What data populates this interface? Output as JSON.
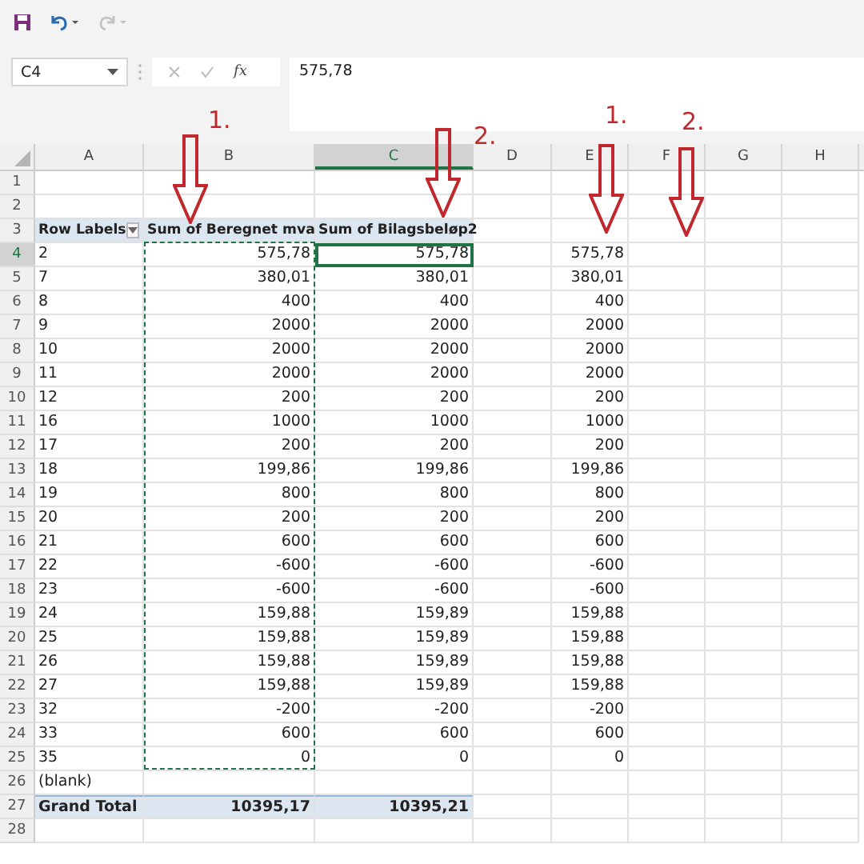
{
  "toolbar": {
    "redo_disabled": true
  },
  "formula_bar": {
    "name_box": "C4",
    "function_label": "fx",
    "value": "575,78"
  },
  "annotations": [
    {
      "label": "1."
    },
    {
      "label": "2."
    },
    {
      "label": "1."
    },
    {
      "label": "2."
    }
  ],
  "columns": [
    {
      "label": "A",
      "selected": false
    },
    {
      "label": "B",
      "selected": false
    },
    {
      "label": "C",
      "selected": true
    },
    {
      "label": "D",
      "selected": false
    },
    {
      "label": "E",
      "selected": false
    },
    {
      "label": "F",
      "selected": false
    },
    {
      "label": "G",
      "selected": false
    },
    {
      "label": "H",
      "selected": false
    }
  ],
  "rows": [
    {
      "n": "1",
      "selected": false
    },
    {
      "n": "2",
      "selected": false
    },
    {
      "n": "3",
      "kind": "header",
      "selected": false,
      "a": "Row Labels",
      "b": "Sum of Beregnet mva",
      "c": "Sum of Bilagsbeløp2"
    },
    {
      "n": "4",
      "selected": true,
      "a": "2",
      "b": "575,78",
      "c": "575,78",
      "e": "575,78"
    },
    {
      "n": "5",
      "selected": false,
      "a": "7",
      "b": "380,01",
      "c": "380,01",
      "e": "380,01"
    },
    {
      "n": "6",
      "selected": false,
      "a": "8",
      "b": "400",
      "c": "400",
      "e": "400"
    },
    {
      "n": "7",
      "selected": false,
      "a": "9",
      "b": "2000",
      "c": "2000",
      "e": "2000"
    },
    {
      "n": "8",
      "selected": false,
      "a": "10",
      "b": "2000",
      "c": "2000",
      "e": "2000"
    },
    {
      "n": "9",
      "selected": false,
      "a": "11",
      "b": "2000",
      "c": "2000",
      "e": "2000"
    },
    {
      "n": "10",
      "selected": false,
      "a": "12",
      "b": "200",
      "c": "200",
      "e": "200"
    },
    {
      "n": "11",
      "selected": false,
      "a": "16",
      "b": "1000",
      "c": "1000",
      "e": "1000"
    },
    {
      "n": "12",
      "selected": false,
      "a": "17",
      "b": "200",
      "c": "200",
      "e": "200"
    },
    {
      "n": "13",
      "selected": false,
      "a": "18",
      "b": "199,86",
      "c": "199,86",
      "e": "199,86"
    },
    {
      "n": "14",
      "selected": false,
      "a": "19",
      "b": "800",
      "c": "800",
      "e": "800"
    },
    {
      "n": "15",
      "selected": false,
      "a": "20",
      "b": "200",
      "c": "200",
      "e": "200"
    },
    {
      "n": "16",
      "selected": false,
      "a": "21",
      "b": "600",
      "c": "600",
      "e": "600"
    },
    {
      "n": "17",
      "selected": false,
      "a": "22",
      "b": "-600",
      "c": "-600",
      "e": "-600"
    },
    {
      "n": "18",
      "selected": false,
      "a": "23",
      "b": "-600",
      "c": "-600",
      "e": "-600"
    },
    {
      "n": "19",
      "selected": false,
      "a": "24",
      "b": "159,88",
      "c": "159,89",
      "e": "159,88"
    },
    {
      "n": "20",
      "selected": false,
      "a": "25",
      "b": "159,88",
      "c": "159,89",
      "e": "159,88"
    },
    {
      "n": "21",
      "selected": false,
      "a": "26",
      "b": "159,88",
      "c": "159,89",
      "e": "159,88"
    },
    {
      "n": "22",
      "selected": false,
      "a": "27",
      "b": "159,88",
      "c": "159,89",
      "e": "159,88"
    },
    {
      "n": "23",
      "selected": false,
      "a": "32",
      "b": "-200",
      "c": "-200",
      "e": "-200"
    },
    {
      "n": "24",
      "selected": false,
      "a": "33",
      "b": "600",
      "c": "600",
      "e": "600"
    },
    {
      "n": "25",
      "selected": false,
      "a": "35",
      "b": "0",
      "c": "0",
      "e": "0"
    },
    {
      "n": "26",
      "selected": false,
      "a": "(blank)"
    },
    {
      "n": "27",
      "kind": "total",
      "selected": false,
      "a": "Grand Total",
      "b": "10395,17",
      "c": "10395,21"
    },
    {
      "n": "28",
      "selected": false
    }
  ],
  "copy_marquee": true
}
